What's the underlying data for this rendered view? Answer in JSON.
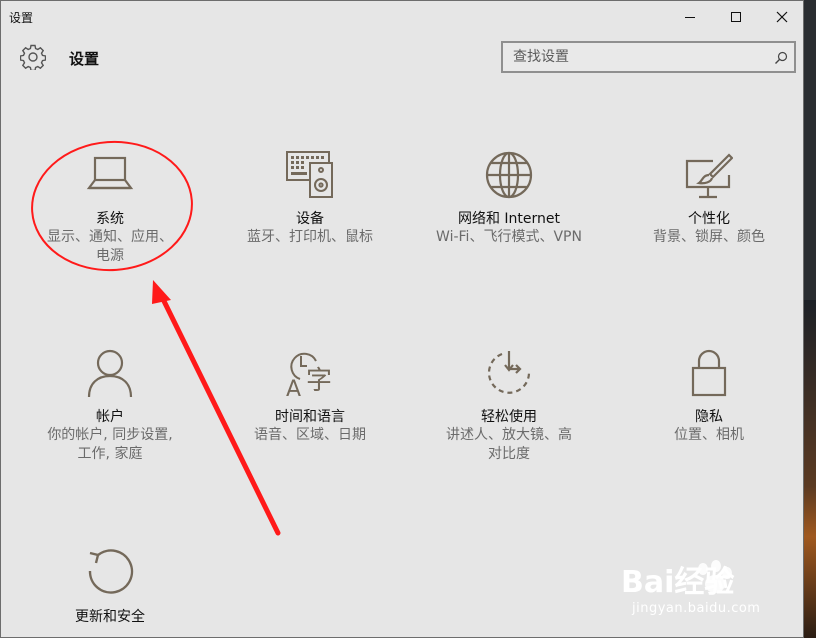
{
  "window": {
    "title": "设置",
    "controls": {
      "minimize": "minimize",
      "maximize": "maximize",
      "close": "close"
    }
  },
  "header": {
    "title": "设置",
    "icon": "gear-icon",
    "search": {
      "placeholder": "查找设置",
      "icon": "search-icon"
    }
  },
  "tiles": [
    {
      "id": "system",
      "icon": "laptop-icon",
      "name": "系统",
      "desc": "显示、通知、应用、电源"
    },
    {
      "id": "devices",
      "icon": "devices-icon",
      "name": "设备",
      "desc": "蓝牙、打印机、鼠标"
    },
    {
      "id": "network",
      "icon": "globe-icon",
      "name": "网络和 Internet",
      "desc": "Wi-Fi、飞行模式、VPN"
    },
    {
      "id": "personalization",
      "icon": "paintbrush-icon",
      "name": "个性化",
      "desc": "背景、锁屏、颜色"
    },
    {
      "id": "accounts",
      "icon": "person-icon",
      "name": "帐户",
      "desc": "你的帐户, 同步设置, 工作, 家庭"
    },
    {
      "id": "time-language",
      "icon": "clock-language-icon",
      "name": "时间和语言",
      "desc": "语音、区域、日期"
    },
    {
      "id": "ease-of-access",
      "icon": "ease-of-access-icon",
      "name": "轻松使用",
      "desc": "讲述人、放大镜、高对比度"
    },
    {
      "id": "privacy",
      "icon": "lock-icon",
      "name": "隐私",
      "desc": "位置、相机"
    },
    {
      "id": "update-security",
      "icon": "refresh-icon",
      "name": "更新和安全",
      "desc": ""
    }
  ],
  "annotation": {
    "color": "#ff1a1a"
  },
  "watermark": {
    "brand": "Bai经验",
    "url": "jingyan.baidu.com"
  },
  "colors": {
    "icon": "#74695a",
    "window_bg": "#e6e6e6",
    "text": "#111111",
    "subtext": "#6b6b6b"
  }
}
